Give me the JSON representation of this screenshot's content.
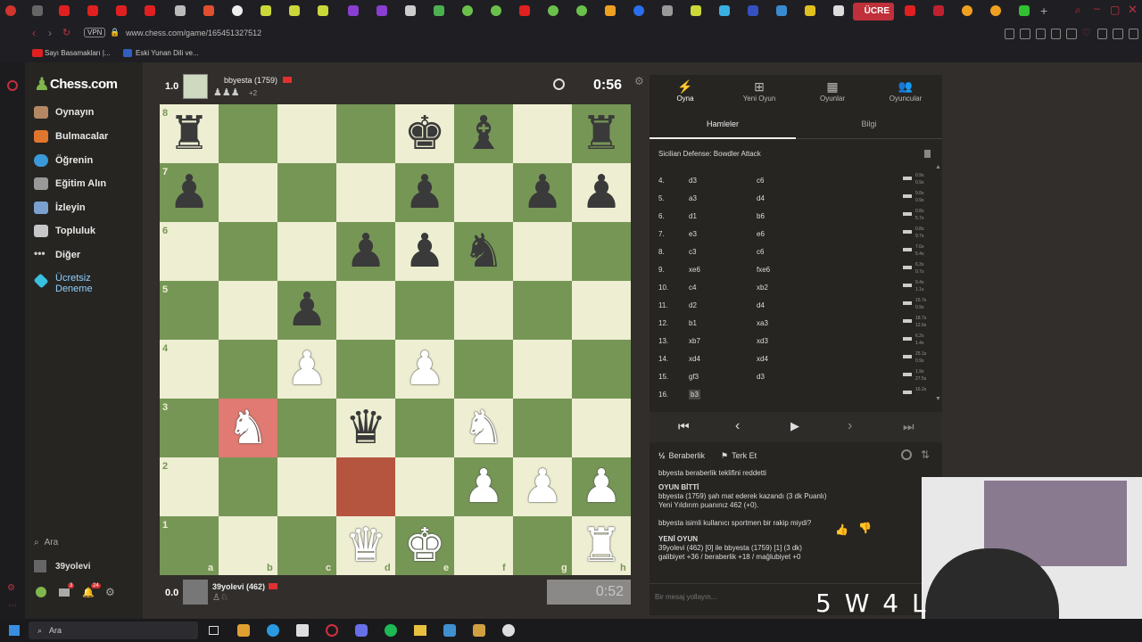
{
  "browser": {
    "url": "www.chess.com/game/165451327512",
    "vpn": "VPN",
    "promo": "ÜCRE",
    "bookmarks": [
      "Sayı Basamakları |...",
      "Eski Yunan Dili ve..."
    ]
  },
  "sidebar": {
    "logo": "Chess.com",
    "items": [
      "Oynayın",
      "Bulmacalar",
      "Öğrenin",
      "Eğitim Alın",
      "İzleyin",
      "Topluluk",
      "Diğer",
      "Ücretsiz Deneme"
    ],
    "search": "Ara",
    "user": "39yolevi",
    "mail_count": "3",
    "notif_count": "24"
  },
  "top_player": {
    "score": "1.0",
    "name": "bbyesta (1759)",
    "extra": "+2",
    "clock": "0:56"
  },
  "bottom_player": {
    "score": "0.0",
    "name": "39yolevi (462)",
    "clock": "0:52"
  },
  "board": {
    "ranks": [
      "8",
      "7",
      "6",
      "5",
      "4",
      "3",
      "2",
      "1"
    ],
    "files": [
      "a",
      "b",
      "c",
      "d",
      "e",
      "f",
      "g",
      "h"
    ],
    "pieces": [
      [
        "r",
        "",
        "",
        "",
        "k",
        "b",
        "",
        "r"
      ],
      [
        "p",
        "",
        "",
        "",
        "p",
        "",
        "p",
        "p"
      ],
      [
        "",
        "",
        "",
        "p",
        "p",
        "n",
        "",
        ""
      ],
      [
        "",
        "",
        "p",
        "",
        "",
        "",
        "",
        ""
      ],
      [
        "",
        "",
        "P",
        "",
        "P",
        "",
        "",
        ""
      ],
      [
        "",
        "N",
        "",
        "q",
        "",
        "N",
        "",
        ""
      ],
      [
        "",
        "",
        "",
        "",
        "",
        "P",
        "P",
        "P"
      ],
      [
        "",
        "",
        "",
        "Q",
        "K",
        "",
        "",
        "R"
      ]
    ],
    "highlights": [
      {
        "square": "b3",
        "color": "#e07a72"
      },
      {
        "square": "d2",
        "color": "#b5553f"
      }
    ]
  },
  "panel": {
    "tabs": [
      "Oyna",
      "Yeni Oyun",
      "Oyunlar",
      "Oyuncular"
    ],
    "subtabs": [
      "Hamleler",
      "Bilgi"
    ],
    "opening": "Sicilian Defense: Bowdler Attack",
    "moves": [
      {
        "n": "4.",
        "w": "d3",
        "b": "c6",
        "wt": "0.9s",
        "bt": "0.9s"
      },
      {
        "n": "5.",
        "w": "a3",
        "b": "d4",
        "wt": "9.8s",
        "bt": "0.9s"
      },
      {
        "n": "6.",
        "w": "d1",
        "b": "b6",
        "wt": "0.8s",
        "bt": "5.7s"
      },
      {
        "n": "7.",
        "w": "e3",
        "b": "e6",
        "wt": "0.8s",
        "bt": "9.7s"
      },
      {
        "n": "8.",
        "w": "c3",
        "b": "c6",
        "wt": "7.6s",
        "bt": "5.4s"
      },
      {
        "n": "9.",
        "w": "xe6",
        "b": "fxe6",
        "wt": "6.3s",
        "bt": "0.7s"
      },
      {
        "n": "10.",
        "w": "c4",
        "b": "xb2",
        "wt": "9.4s",
        "bt": "1.1s"
      },
      {
        "n": "11.",
        "w": "d2",
        "b": "d4",
        "wt": "15.7s",
        "bt": "0.9s"
      },
      {
        "n": "12.",
        "w": "b1",
        "b": "xa3",
        "wt": "18.7s",
        "bt": "12.6s"
      },
      {
        "n": "13.",
        "w": "xb7",
        "b": "xd3",
        "wt": "6.2s",
        "bt": "1.4s"
      },
      {
        "n": "14.",
        "w": "xd4",
        "b": "xd4",
        "wt": "25.1s",
        "bt": "0.9s"
      },
      {
        "n": "15.",
        "w": "gf3",
        "b": "d3",
        "wt": "1.9s",
        "bt": "27.5s"
      },
      {
        "n": "16.",
        "w": "b3",
        "b": "",
        "wt": "16.2s",
        "bt": ""
      }
    ],
    "actions": {
      "draw": "Beraberlik",
      "resign": "Terk Et"
    },
    "chat": [
      "bbyesta beraberlik teklifini reddetti",
      "OYUN BİTTİ",
      "bbyesta (1759) şah mat ederek kazandı (3 dk Puanlı)",
      "Yeni Yıldırım puanınız 462 (+0).",
      "bbyesta isimli kullanıcı sportmen bir rakip miydi?",
      "YENİ OYUN",
      "39yolevi (462) [0] ile bbyesta (1759) [1] (3 dk)",
      "galibiyet +36 / beraberlik +18 / mağlubiyet +0"
    ],
    "chat_placeholder": "Bir mesaj yollayın..."
  },
  "overlay": {
    "score": "5 W 4 L"
  },
  "taskbar": {
    "search": "Ara"
  }
}
